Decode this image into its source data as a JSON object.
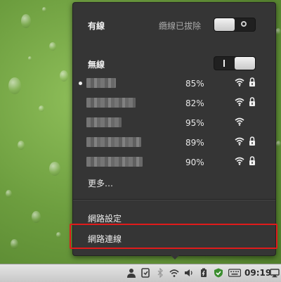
{
  "wired": {
    "title": "有線",
    "status": "纜線已拔除",
    "switch_state": "off"
  },
  "wireless": {
    "title": "無線",
    "switch_state": "on",
    "networks": [
      {
        "name": "",
        "signal": "85%",
        "secured": true,
        "connected": true
      },
      {
        "name": "",
        "signal": "82%",
        "secured": true,
        "connected": false
      },
      {
        "name": "",
        "signal": "95%",
        "secured": false,
        "connected": false
      },
      {
        "name": "",
        "signal": "89%",
        "secured": true,
        "connected": false
      },
      {
        "name": "",
        "signal": "90%",
        "secured": true,
        "connected": false
      }
    ],
    "more_label": "更多…"
  },
  "menu_items": {
    "network_settings": "網路設定",
    "network_connections": "網路連線"
  },
  "taskbar": {
    "clock": "09:19",
    "icons": [
      "user-icon",
      "clipboard-icon",
      "bluetooth-icon",
      "network-icon",
      "volume-icon",
      "battery-icon",
      "shield-icon",
      "keyboard-icon",
      "display-icon"
    ]
  },
  "colors": {
    "menu_bg": "#353535",
    "highlight_border": "#e01b1b",
    "taskbar_bg": "#d6d6d6"
  }
}
